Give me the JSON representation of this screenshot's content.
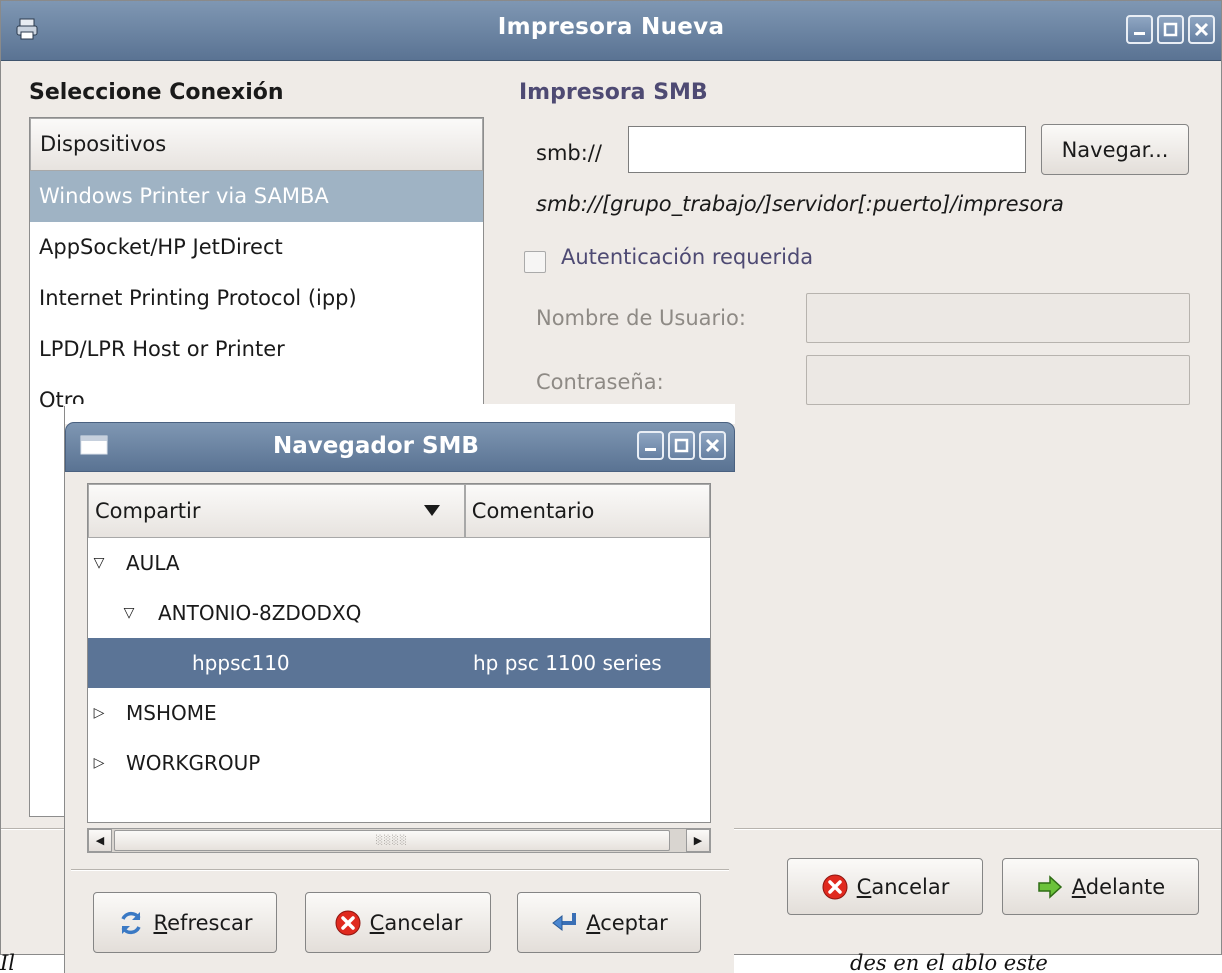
{
  "main_window": {
    "title": "Impresora Nueva",
    "section_title": "Seleccione Conexión",
    "list_header": "Dispositivos",
    "connections": [
      "Windows Printer via SAMBA",
      "AppSocket/HP JetDirect",
      "Internet Printing Protocol (ipp)",
      "LPD/LPR Host or Printer",
      "Otro"
    ],
    "selected_connection": "Windows Printer via SAMBA",
    "smb": {
      "title": "Impresora SMB",
      "prefix": "smb://",
      "uri_value": "",
      "browse_label": "Navegar...",
      "hint": "smb://[grupo_trabajo/]servidor[:puerto]/impresora",
      "auth_label": "Autenticación requerida",
      "auth_checked": false,
      "user_label": "Nombre de Usuario:",
      "password_label": "Contraseña:",
      "user_value": "",
      "password_value": ""
    },
    "buttons": {
      "cancel": {
        "mnemonic": "C",
        "rest": "ancelar"
      },
      "forward": {
        "mnemonic": "A",
        "rest": "delante"
      }
    }
  },
  "smb_browser": {
    "title": "Navegador SMB",
    "columns": {
      "share": "Compartir",
      "comment": "Comentario"
    },
    "tree": [
      {
        "name": "AULA",
        "comment": "",
        "expanded": true,
        "level": 0
      },
      {
        "name": "ANTONIO-8ZDODXQ",
        "comment": "",
        "expanded": true,
        "level": 1
      },
      {
        "name": "hppsc110",
        "comment": "hp psc 1100 series",
        "level": 2,
        "selected": true
      },
      {
        "name": "MSHOME",
        "comment": "",
        "expanded": false,
        "level": 0
      },
      {
        "name": "WORKGROUP",
        "comment": "",
        "expanded": false,
        "level": 0
      }
    ],
    "buttons": {
      "refresh": {
        "mnemonic": "R",
        "rest": "efrescar"
      },
      "cancel": {
        "mnemonic": "C",
        "rest": "ancelar"
      },
      "accept": {
        "mnemonic": "A",
        "rest": "ceptar"
      }
    }
  },
  "caption": {
    "left": "Il",
    "right": "des en el ablo este"
  },
  "icons": {
    "app": "printer-icon",
    "minimize": "minimize-icon",
    "maximize": "maximize-icon",
    "close": "close-icon",
    "refresh": "refresh-icon",
    "cancel": "cancel-icon",
    "accept": "accept-icon",
    "forward": "forward-arrow-icon"
  },
  "colors": {
    "titlebar": "#6b84a5",
    "selection_list": "#9fb3c4",
    "selection_tree": "#5b7496",
    "accent_label": "#4e4a73"
  }
}
